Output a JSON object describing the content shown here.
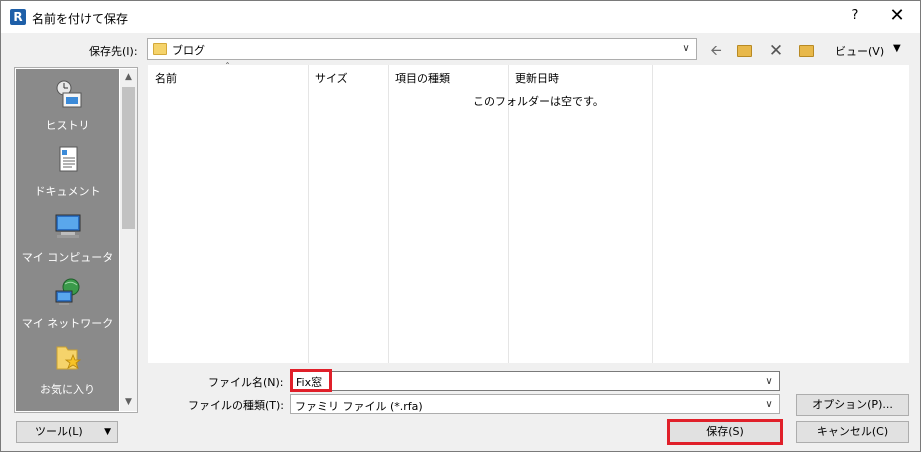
{
  "window": {
    "title": "名前を付けて保存",
    "app_icon_letter": "R",
    "help_label": "?",
    "close_label": "✕"
  },
  "location": {
    "label": "保存先(I):",
    "value": "ブログ"
  },
  "toolbar": {
    "back_icon": "back-arrow-icon",
    "up_icon": "up-folder-icon",
    "delete_icon": "delete-icon",
    "new_folder_icon": "new-folder-icon",
    "view_label": "ビュー(V)"
  },
  "places": [
    {
      "label": "ヒストリ",
      "icon": "history-icon"
    },
    {
      "label": "ドキュメント",
      "icon": "documents-icon"
    },
    {
      "label": "マイ コンピュータ",
      "icon": "computer-icon"
    },
    {
      "label": "マイ ネットワーク",
      "icon": "network-icon"
    },
    {
      "label": "お気に入り",
      "icon": "favorites-icon"
    }
  ],
  "filelist": {
    "columns": [
      "名前",
      "サイズ",
      "項目の種類",
      "更新日時"
    ],
    "empty_message": "このフォルダーは空です。"
  },
  "fields": {
    "filename_label": "ファイル名(N):",
    "filename_value": "Fix窓",
    "filetype_label": "ファイルの種類(T):",
    "filetype_value": "ファミリ ファイル (*.rfa)"
  },
  "buttons": {
    "options": "オプション(P)...",
    "save": "保存(S)",
    "cancel": "キャンセル(C)",
    "tools": "ツール(L)"
  },
  "colors": {
    "highlight": "#e0202a",
    "places_bg": "#8a8a8a"
  }
}
